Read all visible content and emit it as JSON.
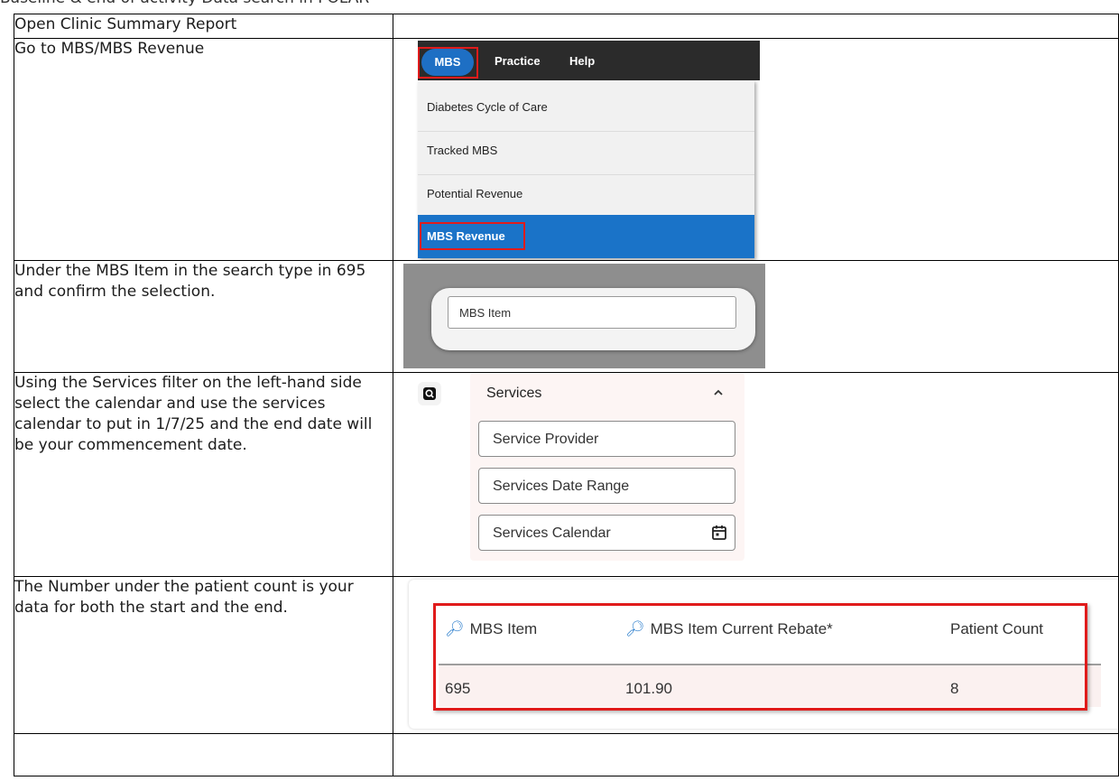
{
  "document": {
    "title": "Baseline & end of activity Data search in POLAR"
  },
  "steps": [
    {
      "text": "Open Clinic Summary Report"
    },
    {
      "text": "Go to MBS/MBS Revenue"
    },
    {
      "text": "Under the MBS Item in the search type in 695 and confirm the selection."
    },
    {
      "text": "Using the Services filter on the left-hand side select the calendar and use the services calendar to put in 1/7/25 and the end date will be your commencement date."
    },
    {
      "text": "The Number under the patient count is your data for both the start and the end."
    },
    {
      "text": ""
    }
  ],
  "menu_screenshot": {
    "bar_items": [
      "MBS",
      "Practice",
      "Help"
    ],
    "dropdown_items": [
      "Diabetes Cycle of Care",
      "Tracked MBS",
      "Potential Revenue",
      "MBS Revenue"
    ],
    "selected_item": "MBS Revenue",
    "highlight_color": "#e01b1b",
    "accent_color": "#1a73c8"
  },
  "search_screenshot": {
    "input_placeholder": "MBS Item"
  },
  "services_screenshot": {
    "section_title": "Services",
    "fields": [
      "Service Provider",
      "Services Date Range",
      "Services Calendar"
    ]
  },
  "patient_count_screenshot": {
    "columns": [
      "MBS Item",
      "MBS Item Current Rebate*",
      "Patient Count"
    ],
    "row": [
      "695",
      "101.90",
      "8"
    ]
  }
}
